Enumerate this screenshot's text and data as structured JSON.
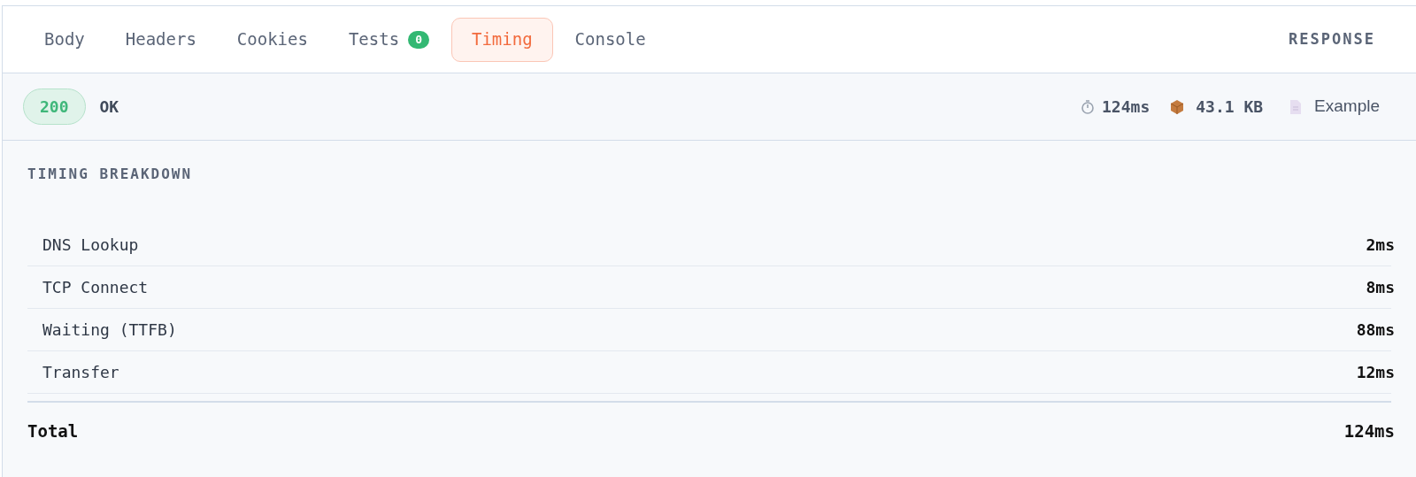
{
  "tabs": [
    {
      "label": "Body",
      "selected": false
    },
    {
      "label": "Headers",
      "selected": false
    },
    {
      "label": "Cookies",
      "selected": false
    },
    {
      "label": "Tests",
      "badge": "0",
      "selected": false
    },
    {
      "label": "Timing",
      "selected": true
    },
    {
      "label": "Console",
      "selected": false
    }
  ],
  "panel_title": "RESPONSE",
  "status": {
    "code": "200",
    "text": "OK",
    "time": "124ms",
    "size": "43.1 KB",
    "environment": "Example"
  },
  "timing": {
    "title": "TIMING BREAKDOWN",
    "rows": [
      {
        "label": "DNS Lookup",
        "value": "2ms"
      },
      {
        "label": "TCP Connect",
        "value": "8ms"
      },
      {
        "label": "Waiting (TTFB)",
        "value": "88ms"
      },
      {
        "label": "Transfer",
        "value": "12ms"
      }
    ],
    "total": {
      "label": "Total",
      "value": "124ms"
    }
  }
}
